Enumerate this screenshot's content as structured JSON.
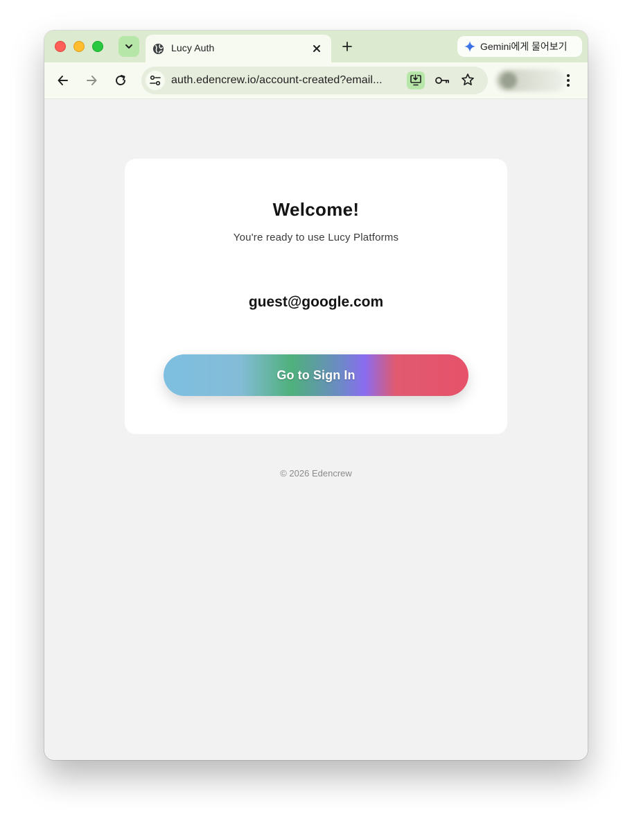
{
  "browser": {
    "tab": {
      "title": "Lucy Auth"
    },
    "gemini_button": {
      "label": "Gemini에게 물어보기"
    },
    "address_bar": {
      "url": "auth.edencrew.io/account-created?email..."
    },
    "icons": {
      "tab_search": "chevron-down-icon",
      "tab_favicon": "globe-icon",
      "tab_close": "close-icon",
      "new_tab": "plus-icon",
      "back": "arrow-left-icon",
      "forward": "arrow-right-icon",
      "reload": "reload-icon",
      "site_info": "tune-icon",
      "install": "install-app-icon",
      "passwords": "key-icon",
      "bookmark": "star-icon",
      "menu": "kebab-menu-icon"
    },
    "colors": {
      "tabstrip": "#dcebcf",
      "toolbar": "#f6faf1",
      "accent_green": "#b6e6a8"
    }
  },
  "page": {
    "card": {
      "heading": "Welcome!",
      "subtitle": "You're ready to use Lucy Platforms",
      "email": "guest@google.com",
      "signin_button_label": "Go to Sign In"
    },
    "footer": {
      "copyright": "© 2026 Edencrew"
    },
    "colors": {
      "page_background": "#f2f2f2",
      "card_background": "#ffffff",
      "button_gradient": [
        "#7dbfe0",
        "#4fb07c",
        "#8a6cf0",
        "#e6526a"
      ]
    }
  }
}
